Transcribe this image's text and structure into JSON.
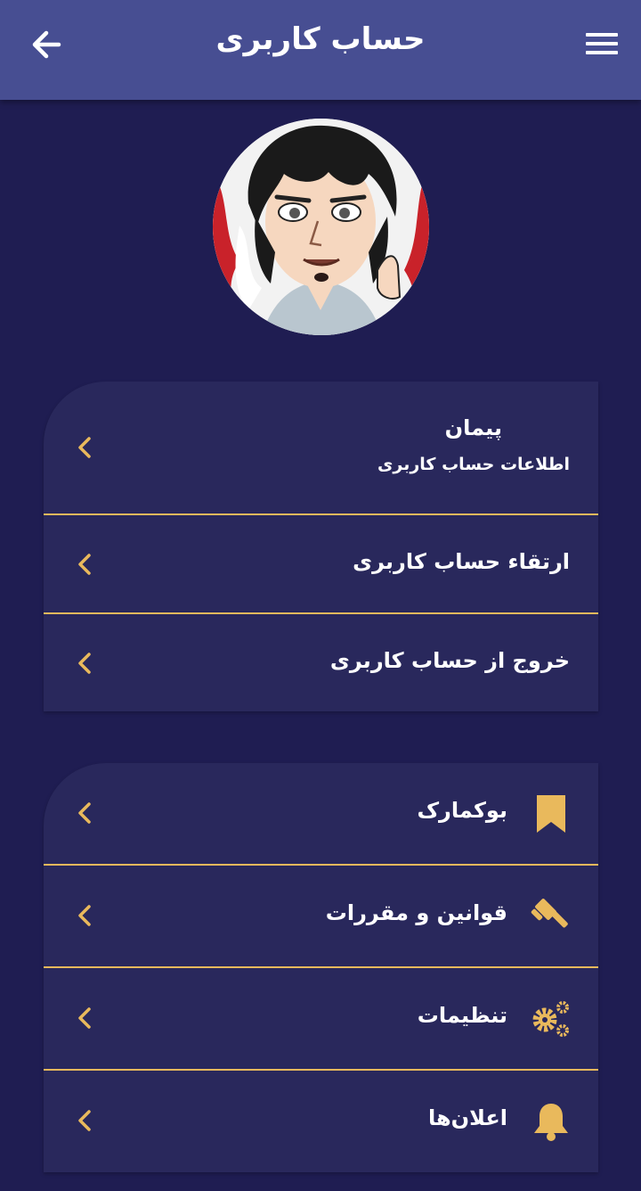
{
  "header": {
    "title": "حساب کاربری",
    "back_icon": "arrow-left-icon",
    "menu_icon": "hamburger-menu-icon"
  },
  "profile": {
    "name": "پیمان",
    "subtitle": "اطلاعات حساب کاربری"
  },
  "account_menu": [
    {
      "label": "ارتقاء حساب کاربری"
    },
    {
      "label": "خروج از حساب کاربری"
    }
  ],
  "main_menu": [
    {
      "label": "بوکمارک",
      "icon": "bookmark-icon"
    },
    {
      "label": "قوانین و مقررات",
      "icon": "gavel-icon"
    },
    {
      "label": "تنظیمات",
      "icon": "gears-icon"
    },
    {
      "label": "اعلان‌ها",
      "icon": "bell-icon"
    }
  ],
  "colors": {
    "background": "#1f1d52",
    "appbar": "#474e92",
    "card": "#29285c",
    "accent": "#e9b95c"
  }
}
